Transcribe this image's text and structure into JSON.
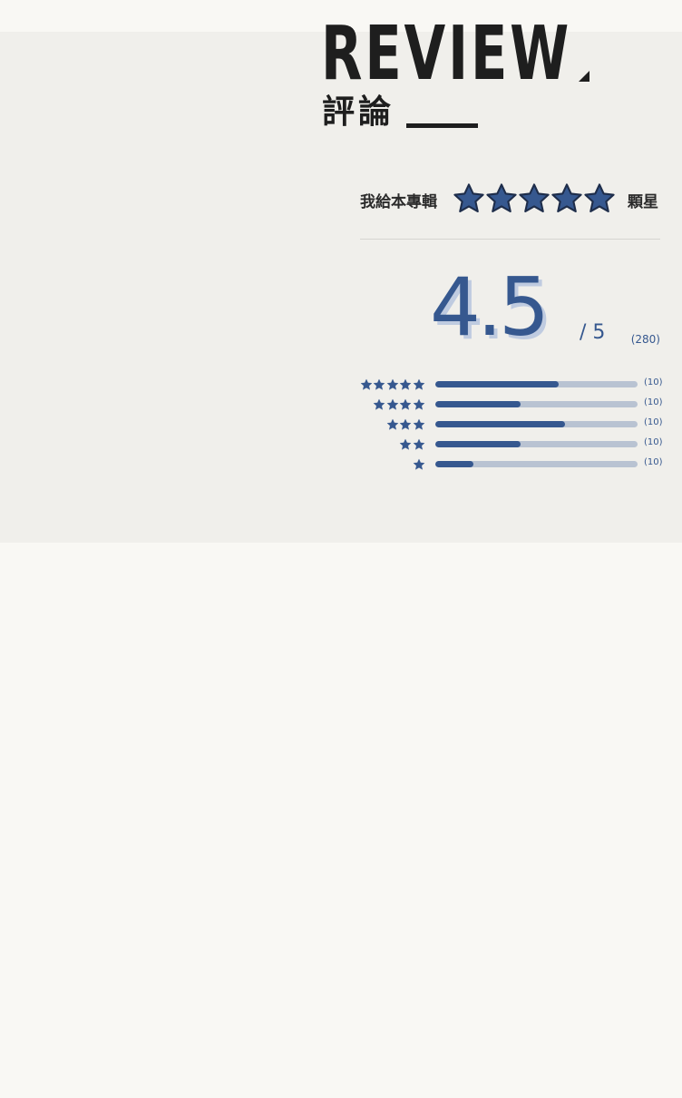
{
  "header": {
    "title": "REVIEW",
    "subtitle": "評論"
  },
  "give_rating": {
    "prefix": "我給本專輯",
    "suffix": "顆星",
    "star_count": 5
  },
  "summary": {
    "score": "4.5",
    "out_of": "/ 5",
    "total": "(280)"
  },
  "distribution": [
    {
      "stars": 5,
      "fill": 0.61,
      "count": "(10)"
    },
    {
      "stars": 4,
      "fill": 0.42,
      "count": "(10)"
    },
    {
      "stars": 3,
      "fill": 0.64,
      "count": "(10)"
    },
    {
      "stars": 2,
      "fill": 0.42,
      "count": "(10)"
    },
    {
      "stars": 1,
      "fill": 0.19,
      "count": "(10)"
    }
  ],
  "icons": {
    "star": "star-icon"
  },
  "colors": {
    "background": "#f9f8f4",
    "panel": "#f0efeb",
    "accent": "#36588f",
    "track": "#b9c3d2",
    "score_shadow": "#bfcbe0",
    "text_dark": "#1e1e1e"
  }
}
